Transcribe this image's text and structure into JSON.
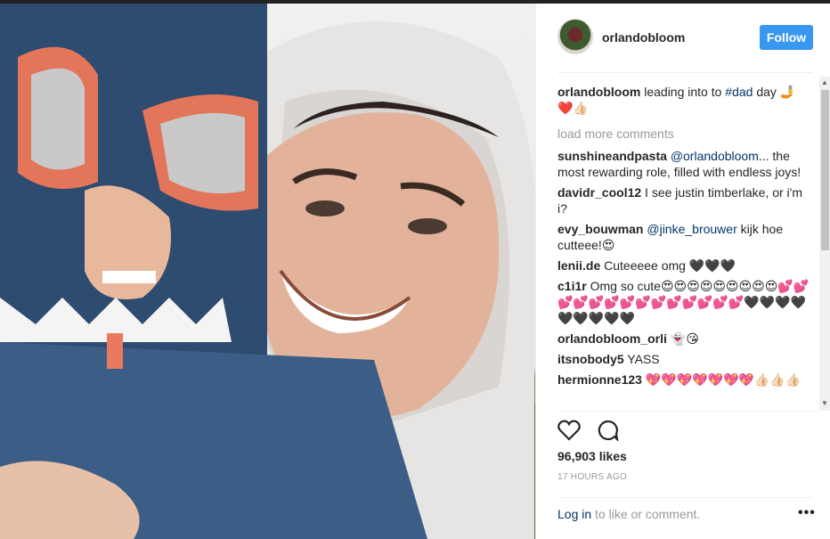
{
  "post": {
    "username": "orlandobloom",
    "follow_label": "Follow",
    "caption_user": "orlandobloom",
    "caption_text": "leading into to",
    "caption_hashtag": "#dad",
    "caption_tail": "day",
    "caption_emoji_1": "🤳",
    "caption_emoji_2": "❤️👍🏻",
    "load_more": "load more comments",
    "comments": [
      {
        "user": "sunshineandpasta",
        "mention": "@orlandobloom",
        "text": "... the most rewarding role, filled with endless joys!"
      },
      {
        "user": "davidr_cool12",
        "mention": "",
        "text": "I see justin timberlake, or i'm i?"
      },
      {
        "user": "evy_bouwman",
        "mention": "@jinke_brouwer",
        "text": "kijk hoe cutteee!😍"
      },
      {
        "user": "lenii.de",
        "mention": "",
        "text": "Cuteeeee omg 🖤🖤🖤"
      },
      {
        "user": "c1i1r",
        "mention": "",
        "text": "Omg so cute😍😍😍😍😍😍😍😍😍💕💕💕💕💕💕💕💕💕💕💕💕💕💕🖤🖤🖤🖤🖤🖤🖤🖤🖤"
      },
      {
        "user": "orlandobloom_orli",
        "mention": "",
        "text": "👻😘"
      },
      {
        "user": "itsnobody5",
        "mention": "",
        "text": "YASS"
      },
      {
        "user": "hermionne123",
        "mention": "",
        "text": "💖💖💖💖💖💖💖👍🏻👍🏻👍🏻"
      }
    ],
    "likes": "96,903 likes",
    "time": "17 HOURS AGO",
    "login_link": "Log in",
    "login_text": "to like or comment.",
    "more_label": "•••"
  },
  "icons": {
    "like": "heart-icon",
    "comment": "comment-icon",
    "more": "more-options-icon"
  },
  "colors": {
    "follow_button": "#3897f0",
    "link": "#003569",
    "muted": "#999999"
  }
}
